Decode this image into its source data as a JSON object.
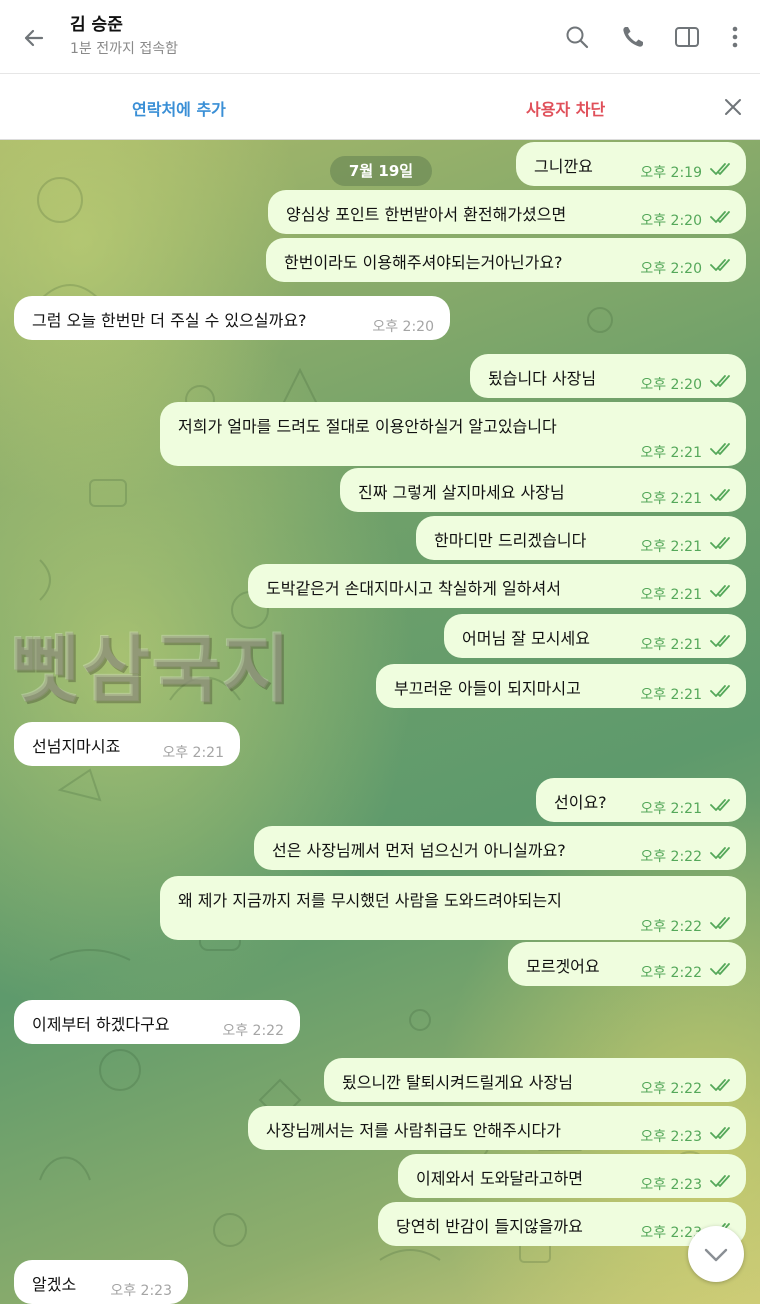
{
  "header": {
    "title": "김 승준",
    "status": "1분 전까지 접속함"
  },
  "actionbar": {
    "add_contact": "연락처에 추가",
    "block_user": "사용자 차단"
  },
  "chat": {
    "date_chip": "7월 19일",
    "watermark": "뻿삼국지",
    "messages": [
      {
        "dir": "out",
        "text": "그니깐요",
        "time": "오후 2:19"
      },
      {
        "dir": "out",
        "text": "양심상 포인트 한번받아서 환전해가셨으면",
        "time": "오후 2:20"
      },
      {
        "dir": "out",
        "text": "한번이라도 이용해주셔야되는거아닌가요?",
        "time": "오후 2:20"
      },
      {
        "dir": "in",
        "text": "그럼 오늘 한번만 더 주실 수 있으실까요?",
        "time": "오후 2:20"
      },
      {
        "dir": "out",
        "text": "됬습니다 사장님",
        "time": "오후 2:20"
      },
      {
        "dir": "out",
        "text": "저희가 얼마를 드려도 절대로 이용안하실거 알고있습니다",
        "time": "오후 2:21"
      },
      {
        "dir": "out",
        "text": "진짜 그렇게 살지마세요 사장님",
        "time": "오후 2:21"
      },
      {
        "dir": "out",
        "text": "한마디만 드리겠습니다",
        "time": "오후 2:21"
      },
      {
        "dir": "out",
        "text": "도박같은거 손대지마시고 착실하게 일하셔서",
        "time": "오후 2:21"
      },
      {
        "dir": "out",
        "text": "어머님 잘 모시세요",
        "time": "오후 2:21"
      },
      {
        "dir": "out",
        "text": "부끄러운 아들이 되지마시고",
        "time": "오후 2:21"
      },
      {
        "dir": "in",
        "text": "선넘지마시죠",
        "time": "오후 2:21"
      },
      {
        "dir": "out",
        "text": "선이요?",
        "time": "오후 2:21"
      },
      {
        "dir": "out",
        "text": "선은 사장님께서 먼저 넘으신거 아니실까요?",
        "time": "오후 2:22"
      },
      {
        "dir": "out",
        "text": "왜 제가 지금까지 저를 무시했던 사람을 도와드려야되는지",
        "time": "오후 2:22"
      },
      {
        "dir": "out",
        "text": "모르겟어요",
        "time": "오후 2:22"
      },
      {
        "dir": "in",
        "text": "이제부터 하겠다구요",
        "time": "오후 2:22"
      },
      {
        "dir": "out",
        "text": "됬으니깐 탈퇴시켜드릴게요 사장님",
        "time": "오후 2:22"
      },
      {
        "dir": "out",
        "text": "사장님께서는 저를 사람취급도 안해주시다가",
        "time": "오후 2:23"
      },
      {
        "dir": "out",
        "text": "이제와서 도와달라고하면",
        "time": "오후 2:23"
      },
      {
        "dir": "out",
        "text": "당연히 반감이 들지않을까요",
        "time": "오후 2:23"
      },
      {
        "dir": "in",
        "text": "알겠소",
        "time": "오후 2:23"
      }
    ]
  },
  "colors": {
    "link_blue": "#3a8fd6",
    "danger_red": "#e0505a",
    "out_bubble": "#effdde",
    "out_time": "#55a85a",
    "in_bubble": "#ffffff"
  },
  "icons": [
    "back-arrow-icon",
    "search-icon",
    "phone-icon",
    "sidebar-toggle-icon",
    "more-vertical-icon",
    "close-icon",
    "double-check-icon",
    "chevron-down-icon"
  ]
}
